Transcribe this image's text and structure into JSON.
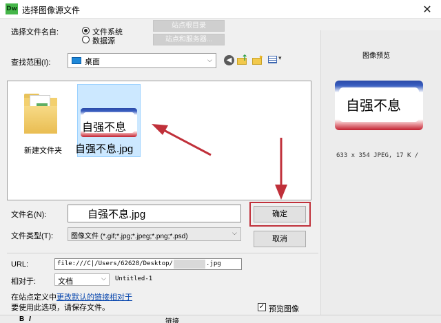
{
  "window": {
    "app_icon": "Dw",
    "title": "选择图像源文件",
    "close": "✕"
  },
  "select_from": {
    "label": "选择文件名自:",
    "options": [
      "文件系统",
      "数据源"
    ],
    "selected": "文件系统",
    "site_root_button": "站点根目录",
    "site_server_button": "站点和服务器..."
  },
  "look_in": {
    "label": "查找范围(I):",
    "value": "桌面"
  },
  "files": [
    {
      "name": "新建文件夹",
      "type": "folder-icon"
    },
    {
      "name": "自强不息.jpg",
      "thumb_text": "自强不息",
      "selected": true
    }
  ],
  "preview": {
    "title": "图像预览",
    "image_text": "自强不息",
    "info": "633 x 354 JPEG, 17 K /"
  },
  "file_name": {
    "label": "文件名(N):",
    "value": "自强不息.jpg",
    "ok_button": "确定"
  },
  "file_type": {
    "label": "文件类型(T):",
    "value": "图像文件 (*.gif;*.jpg;*.jpeg;*.png;*.psd)",
    "cancel_button": "取消"
  },
  "url": {
    "label": "URL:",
    "value": "file:///C|/Users/62628/Desktop/",
    "suffix": ".jpg"
  },
  "relative_to": {
    "label": "相对于:",
    "value": "文档",
    "doc": "Untitled-1"
  },
  "footer": {
    "note_prefix": "在站点定义中",
    "note_link": "更改默认的链接相对于",
    "note2": "要使用此选项，请保存文件。",
    "preview_checkbox": "预览图像",
    "preview_checked": true
  },
  "background_strip": {
    "tokens": [
      "B",
      "I",
      "链接"
    ]
  },
  "colors": {
    "accent_red": "#c0303a",
    "selection": "#cce8ff",
    "brand_green": "#45b649"
  }
}
